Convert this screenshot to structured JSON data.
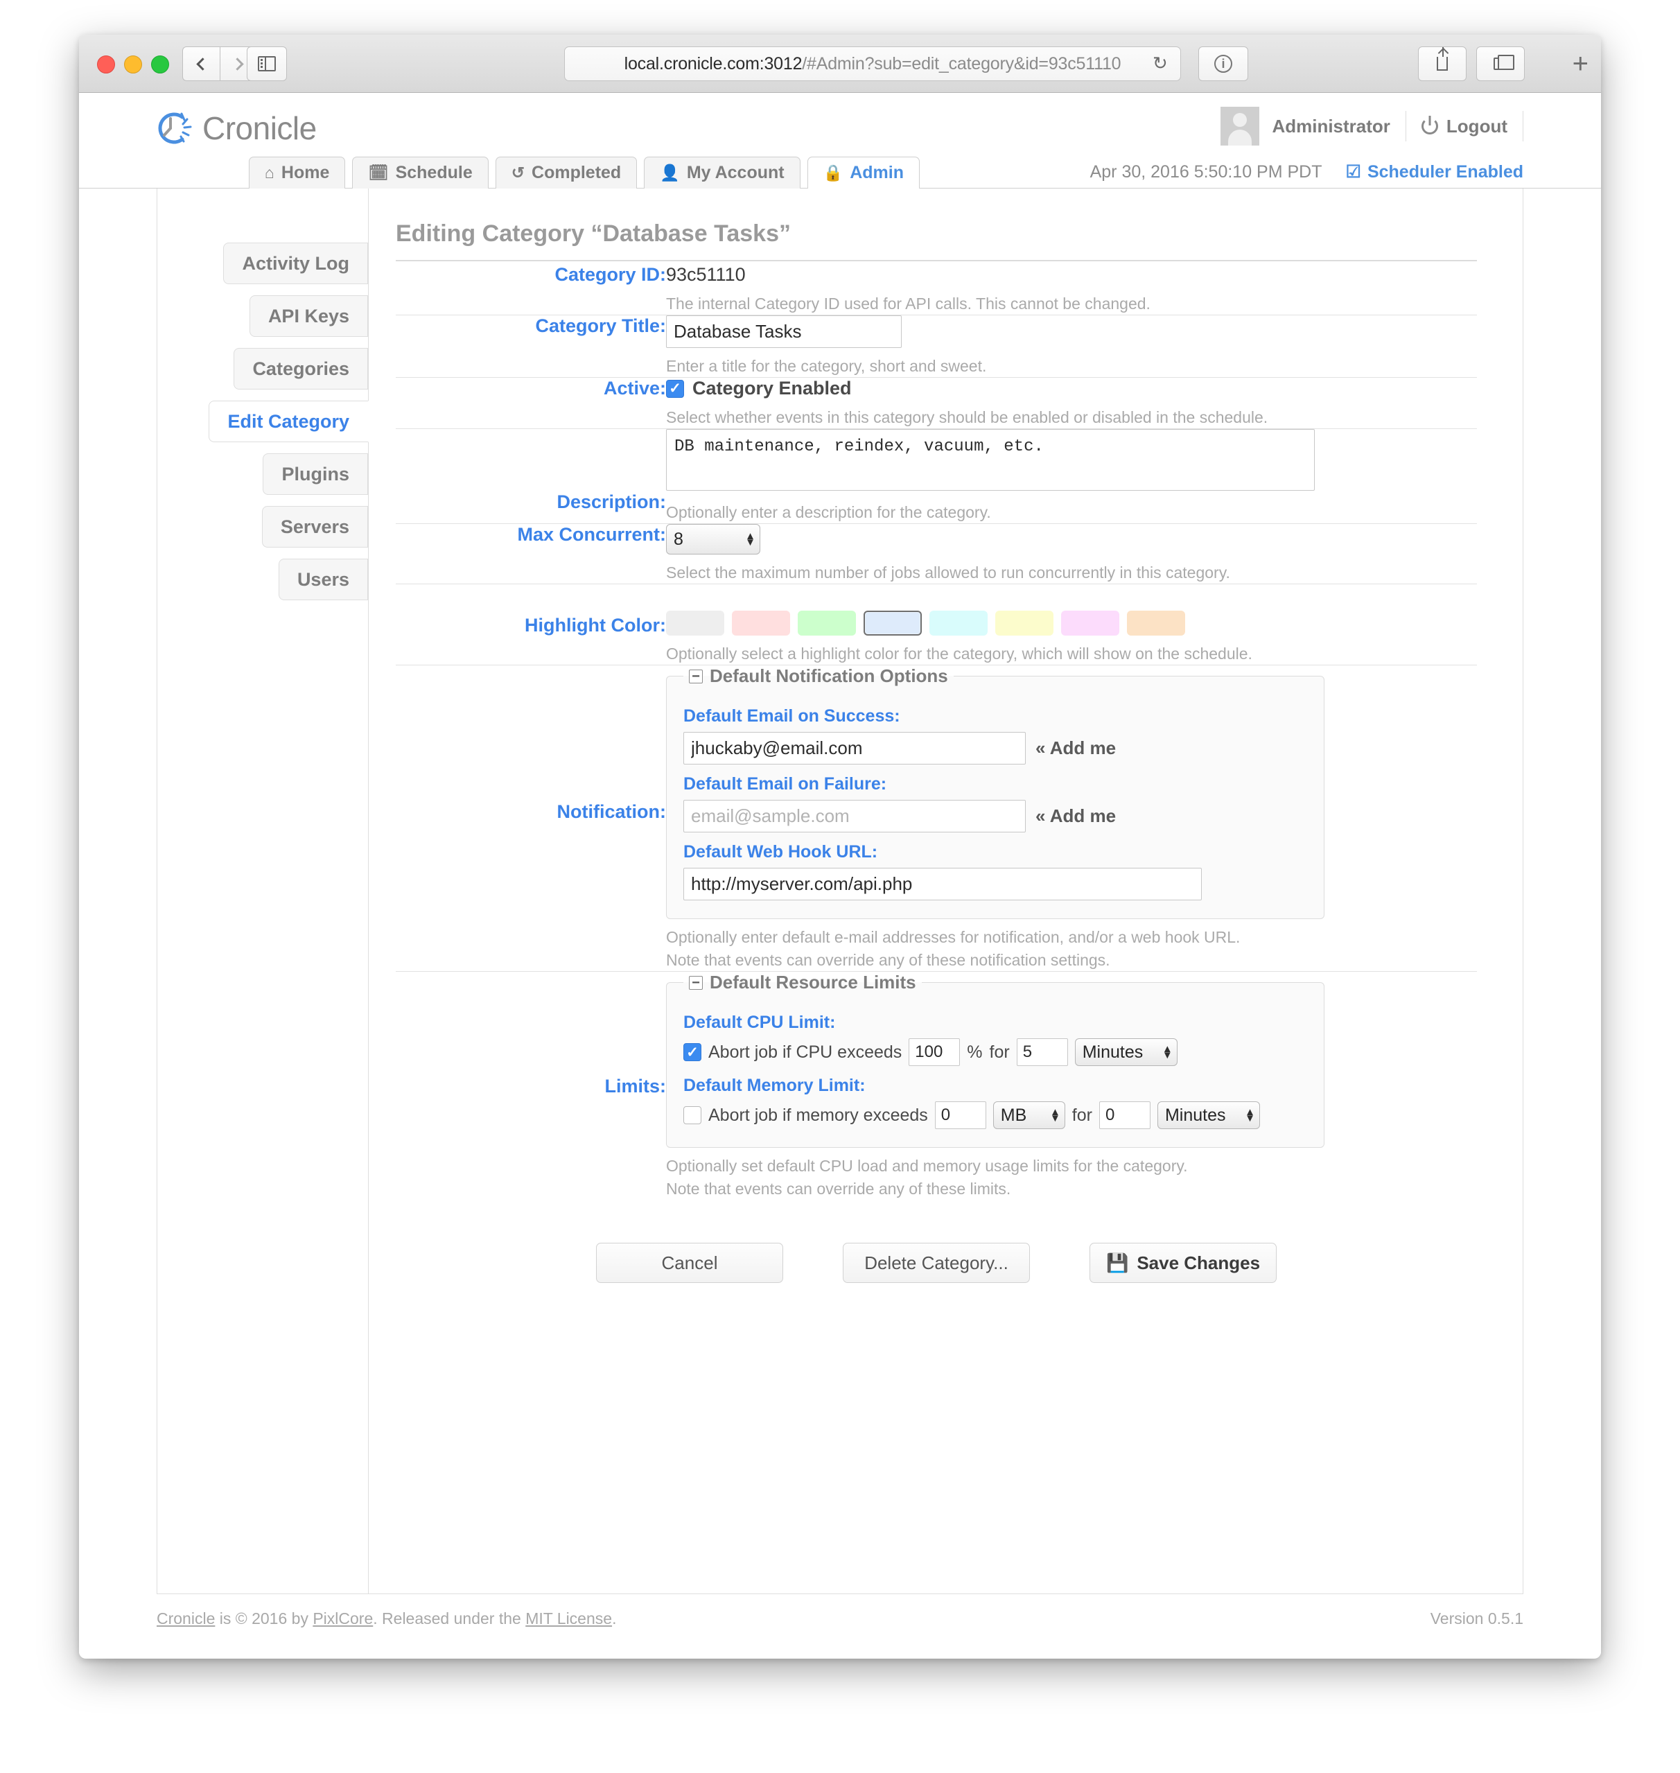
{
  "browser": {
    "url_prefix": "local.cronicle.com:3012",
    "url_suffix": "/#Admin?sub=edit_category&id=93c51110",
    "reload_icon": "reload-icon",
    "info_icon": "info-icon",
    "share_icon": "share-icon",
    "tabs_icon": "tabs-icon",
    "new_tab_label": "+"
  },
  "header": {
    "brand": "Cronicle",
    "username": "Administrator",
    "logout_label": "Logout"
  },
  "nav": {
    "tabs": [
      {
        "label": "Home",
        "icon": "home-icon",
        "glyph": "⌂",
        "active": false
      },
      {
        "label": "Schedule",
        "icon": "calendar-clock-icon",
        "glyph": "▦",
        "active": false
      },
      {
        "label": "Completed",
        "icon": "history-icon",
        "glyph": "↺",
        "active": false
      },
      {
        "label": "My Account",
        "icon": "user-icon",
        "glyph": "👤",
        "active": false
      },
      {
        "label": "Admin",
        "icon": "lock-icon",
        "glyph": "🔒",
        "active": true
      }
    ],
    "datetime": "Apr 30, 2016 5:50:10 PM PDT",
    "scheduler_status": "Scheduler Enabled",
    "scheduler_icon": "checkbox-checked-icon"
  },
  "sidebar": {
    "items": [
      {
        "label": "Activity Log",
        "active": false
      },
      {
        "label": "API Keys",
        "active": false
      },
      {
        "label": "Categories",
        "active": false
      },
      {
        "label": "Edit Category",
        "active": true
      },
      {
        "label": "Plugins",
        "active": false
      },
      {
        "label": "Servers",
        "active": false
      },
      {
        "label": "Users",
        "active": false
      }
    ]
  },
  "main": {
    "title": "Editing Category “Database Tasks”",
    "category_id": {
      "label": "Category ID:",
      "value": "93c51110",
      "hint": "The internal Category ID used for API calls. This cannot be changed."
    },
    "category_title": {
      "label": "Category Title:",
      "value": "Database Tasks",
      "hint": "Enter a title for the category, short and sweet."
    },
    "active": {
      "label": "Active:",
      "checkbox_label": "Category Enabled",
      "checked": true,
      "hint": "Select whether events in this category should be enabled or disabled in the schedule."
    },
    "description": {
      "label": "Description:",
      "value": "DB maintenance, reindex, vacuum, etc.",
      "hint": "Optionally enter a description for the category."
    },
    "max_concurrent": {
      "label": "Max Concurrent:",
      "value": "8",
      "hint": "Select the maximum number of jobs allowed to run concurrently in this category."
    },
    "highlight_color": {
      "label": "Highlight Color:",
      "hint": "Optionally select a highlight color for the category, which will show on the schedule.",
      "swatches": [
        {
          "name": "none",
          "hex": "#eeeeee",
          "selected": false
        },
        {
          "name": "red",
          "hex": "#ffdfdf",
          "selected": false
        },
        {
          "name": "green",
          "hex": "#ccffcc",
          "selected": false
        },
        {
          "name": "blue",
          "hex": "#deebfb",
          "selected": true
        },
        {
          "name": "cyan",
          "hex": "#d9fcfc",
          "selected": false
        },
        {
          "name": "yellow",
          "hex": "#fcfccc",
          "selected": false
        },
        {
          "name": "purple",
          "hex": "#fcdcfc",
          "selected": false
        },
        {
          "name": "orange",
          "hex": "#fce2c5",
          "selected": false
        }
      ]
    },
    "notification": {
      "label": "Notification:",
      "legend": "Default Notification Options",
      "email_success_label": "Default Email on Success:",
      "email_success_value": "jhuckaby@email.com",
      "email_success_placeholder": "email@sample.com",
      "email_success_addme": "« Add me",
      "email_failure_label": "Default Email on Failure:",
      "email_failure_value": "",
      "email_failure_placeholder": "email@sample.com",
      "email_failure_addme": "« Add me",
      "webhook_label": "Default Web Hook URL:",
      "webhook_value": "http://myserver.com/api.php",
      "hint_line1": "Optionally enter default e-mail addresses for notification, and/or a web hook URL.",
      "hint_line2": "Note that events can override any of these notification settings."
    },
    "limits": {
      "label": "Limits:",
      "legend": "Default Resource Limits",
      "cpu_label": "Default CPU Limit:",
      "cpu_checked": true,
      "cpu_text_before": "Abort job if CPU exceeds",
      "cpu_value": "100",
      "cpu_unit": "%",
      "cpu_for": "for",
      "cpu_duration": "5",
      "cpu_duration_unit": "Minutes",
      "mem_label": "Default Memory Limit:",
      "mem_checked": false,
      "mem_text_before": "Abort job if memory exceeds",
      "mem_value": "0",
      "mem_unit": "MB",
      "mem_for": "for",
      "mem_duration": "0",
      "mem_duration_unit": "Minutes",
      "hint_line1": "Optionally set default CPU load and memory usage limits for the category.",
      "hint_line2": "Note that events can override any of these limits."
    },
    "buttons": {
      "cancel": "Cancel",
      "delete": "Delete Category...",
      "save": "Save Changes",
      "save_icon": "floppy-disk-icon"
    }
  },
  "footer": {
    "text_1": "Cronicle",
    "text_2": " is © 2016 by ",
    "text_3": "PixlCore",
    "text_4": ". Released under the ",
    "text_5": "MIT License",
    "text_6": ".",
    "version": "Version 0.5.1"
  }
}
